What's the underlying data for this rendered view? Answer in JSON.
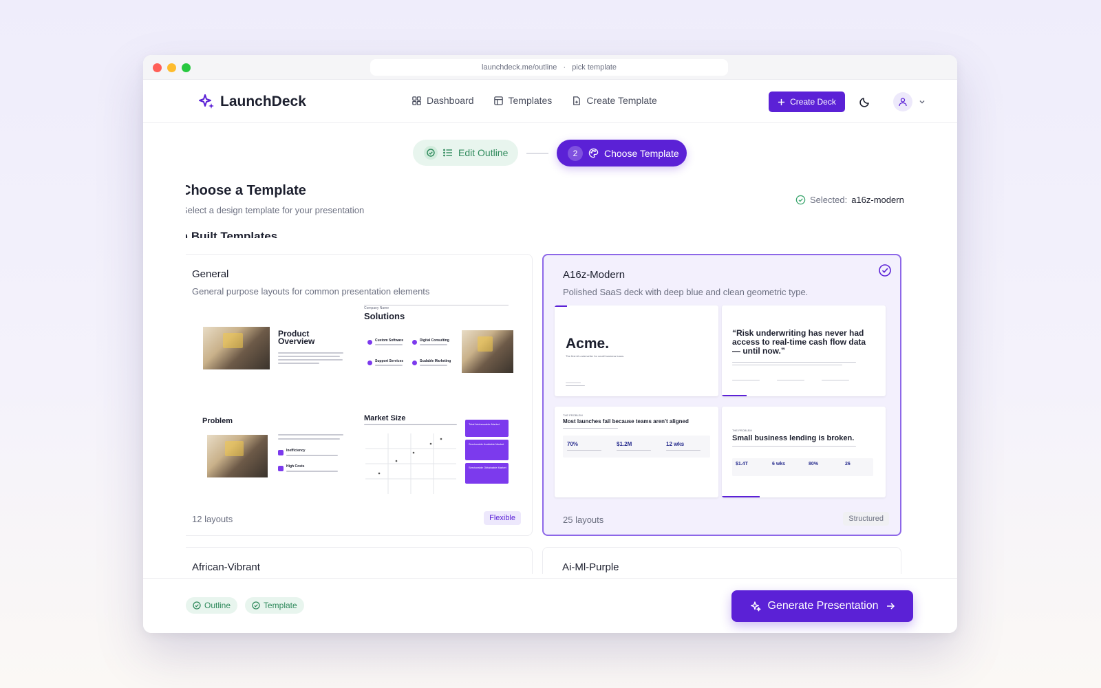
{
  "browser": {
    "url": "launchdeck.me/outline",
    "separator": "·",
    "page": "pick template"
  },
  "brand": {
    "name": "LaunchDeck",
    "accent": "#5b21d6"
  },
  "nav": {
    "links": [
      {
        "label": "Dashboard",
        "icon": "grid-icon"
      },
      {
        "label": "Templates",
        "icon": "layout-icon"
      },
      {
        "label": "Create Template",
        "icon": "file-plus-icon"
      }
    ],
    "create_label": "Create Deck"
  },
  "stepper": {
    "step1": {
      "label": "Edit Outline",
      "status": "done"
    },
    "step2": {
      "number": "2",
      "label": "Choose Template",
      "status": "active"
    }
  },
  "page": {
    "title": "Choose a Template",
    "subtitle": "Select a design template for your presentation",
    "selected_label": "Selected:",
    "selected_value": "a16z-modern",
    "section_title": "In Built Templates"
  },
  "templates": [
    {
      "name": "General",
      "description": "General purpose layouts for common presentation elements",
      "layouts": "12 layouts",
      "badge": "Flexible",
      "previews": {
        "p1_title": "Product Overview",
        "p2_kicker": "Company Name",
        "p2_title": "Solutions",
        "p2_items": [
          "Custom Software",
          "Digital Consulting",
          "Support Services",
          "Scalable Marketing"
        ],
        "p3_title": "Problem",
        "p3_items": [
          "Inefficiency",
          "High Costs"
        ],
        "p4_title": "Market Size",
        "p4_items": [
          "Total Addressable Market",
          "Serviceable Available Market",
          "Serviceable Obtainable Market"
        ]
      }
    },
    {
      "name": "A16z-Modern",
      "description": "Polished SaaS deck with deep blue and clean geometric type.",
      "layouts": "25 layouts",
      "badge": "Structured",
      "selected": true,
      "previews": {
        "p1_title": "Acme.",
        "p1_sub": "The first AI underwriter for small business loans.",
        "p2_quote": "“Risk underwriting has never had access to real-time cash flow data — until now.”",
        "p3_kicker": "THE PROBLEM",
        "p3_title": "Most launches fail because teams aren't aligned",
        "p3_stats": [
          "70%",
          "$1.2M",
          "12 wks"
        ],
        "p4_kicker": "THE PROBLEM",
        "p4_title": "Small business lending is broken.",
        "p4_stats": [
          "$1.4T",
          "6 wks",
          "80%",
          "26"
        ]
      }
    },
    {
      "name": "African-Vibrant"
    },
    {
      "name": "Ai-Ml-Purple"
    }
  ],
  "footer": {
    "chips": [
      "Outline",
      "Template"
    ],
    "generate_label": "Generate Presentation"
  }
}
